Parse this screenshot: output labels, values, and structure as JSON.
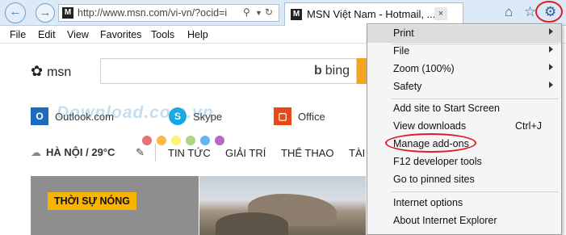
{
  "browser": {
    "address_url": "http://www.msn.com/vi-vn/?ocid=i",
    "site_icon": "M",
    "tab_title": "MSN Việt Nam - Hotmail, ...",
    "tab_close": "×",
    "icons": [
      "back-arrow",
      "forward-arrow",
      "search",
      "dropdown",
      "refresh",
      "close",
      "home",
      "favorites-star",
      "tools-gear"
    ]
  },
  "menubar": [
    "File",
    "Edit",
    "View",
    "Favorites",
    "Tools",
    "Help"
  ],
  "page": {
    "logo_text": "msn",
    "search_brand": "bing",
    "quick_links": [
      {
        "label": "Outlook.com",
        "icon": "outlook-icon"
      },
      {
        "label": "Skype",
        "icon": "skype-icon"
      },
      {
        "label": "Office",
        "icon": "office-icon"
      }
    ],
    "weather": {
      "city": "HÀ NỘI",
      "temp": "29°C"
    },
    "nav": [
      "TIN TỨC",
      "GIẢI TRÍ",
      "THỂ THAO",
      "TÀI"
    ],
    "badge": "THỜI SỰ NÓNG"
  },
  "watermark": {
    "text": "Download.com.vn",
    "dot_colors": [
      "#e57373",
      "#ffb74d",
      "#fff176",
      "#aed581",
      "#64b5f6",
      "#ba68c8"
    ]
  },
  "tools_menu": {
    "print": "Print",
    "file": "File",
    "zoom": "Zoom (100%)",
    "safety": "Safety",
    "add_site": "Add site to Start Screen",
    "view_downloads": "View downloads",
    "view_downloads_shortcut": "Ctrl+J",
    "manage_addons": "Manage add-ons",
    "f12_tools": "F12 developer tools",
    "pinned_sites": "Go to pinned sites",
    "internet_options": "Internet options",
    "about_ie": "About Internet Explorer"
  },
  "colors": {
    "accent": "#2d5d93",
    "annotation": "#e01b24",
    "search_button": "#f3a625",
    "badge": "#f8b400"
  }
}
